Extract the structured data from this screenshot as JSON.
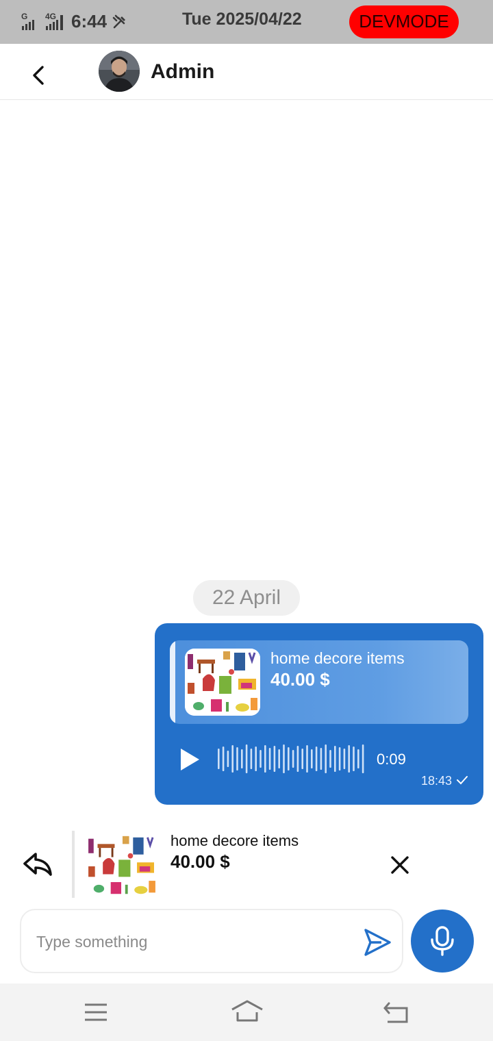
{
  "status_bar": {
    "time": "6:44",
    "date": "Tue 2025/04/22",
    "devmode": "DEVMODE",
    "icons": [
      "signal-g-icon",
      "signal-4g-icon",
      "tools-icon"
    ]
  },
  "header": {
    "title": "Admin",
    "back_icon": "chevron-left-icon",
    "avatar": "user-avatar"
  },
  "chat": {
    "date_chip": "22 April",
    "message": {
      "product_name": "home decore items",
      "product_price": "40.00 $",
      "voice_duration": "0:09",
      "time": "18:43",
      "status_icon": "check-icon",
      "bubble_color": "#2370c9"
    }
  },
  "reply_preview": {
    "product_name": "home decore items",
    "product_price": "40.00 $",
    "reply_icon": "reply-icon",
    "close_icon": "close-icon"
  },
  "composer": {
    "placeholder": "Type something",
    "send_icon": "send-icon",
    "mic_icon": "mic-icon",
    "accent": "#2370c9"
  },
  "nav_bar": {
    "icons": [
      "menu-icon",
      "home-icon",
      "back-icon"
    ]
  }
}
